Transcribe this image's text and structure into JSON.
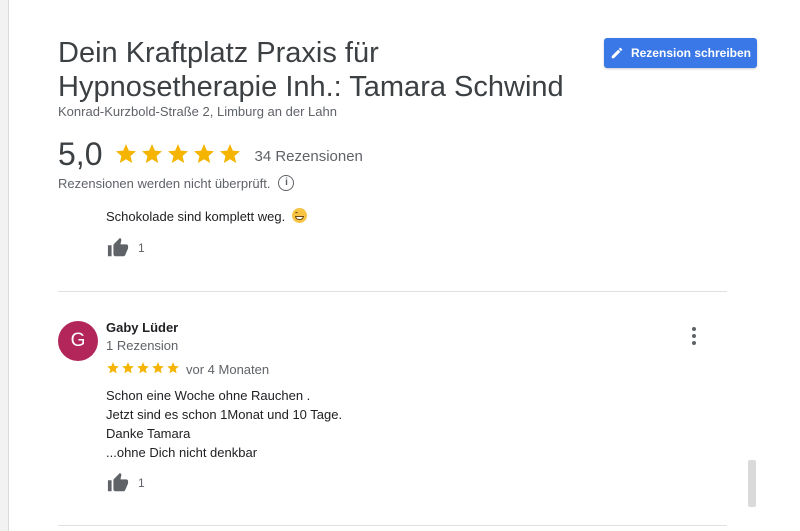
{
  "business": {
    "name": "Dein Kraftplatz Praxis für Hypnosetherapie Inh.: Tamara Schwind",
    "address": "Konrad-Kurzbold-Straße 2, Limburg an der Lahn"
  },
  "write_review_label": "Rezension schreiben",
  "rating": {
    "value": "5,0",
    "stars": 5,
    "count_label": "34 Rezensionen",
    "not_verified": "Rezensionen werden nicht überprüft."
  },
  "previous_review": {
    "text_tail": "Schokolade sind komplett weg.",
    "likes": "1"
  },
  "review": {
    "avatar_letter": "G",
    "avatar_color": "#b3265a",
    "name": "Gaby Lüder",
    "reviewer_count": "1 Rezension",
    "stars": 5,
    "time": "vor 4 Monaten",
    "lines": [
      "Schon eine Woche ohne Rauchen .",
      "Jetzt sind es schon 1Monat und 10 Tage.",
      "Danke Tamara",
      "...ohne Dich nicht denkbar"
    ],
    "likes": "1"
  },
  "colors": {
    "accent": "#3b78e7",
    "star": "#f4b400",
    "text_secondary": "#5f6368"
  },
  "icons": {
    "edit": "pencil-icon",
    "info": "info-icon",
    "like": "thumb-up-icon",
    "more": "more-vert-icon",
    "star": "star-icon"
  }
}
